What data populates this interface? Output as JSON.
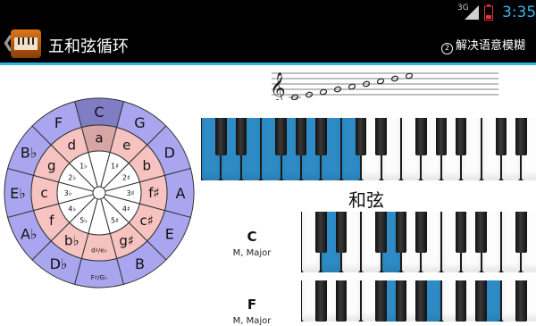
{
  "status_bar": {
    "network": "3G",
    "time": "3:35"
  },
  "app": {
    "title": "五和弦循环",
    "fuzzy_label": "解决语意模糊",
    "back_icon": "chevron-left-icon",
    "fuzzy_icon": "circle-2-icon"
  },
  "staff": {
    "notes": [
      "C4",
      "D4",
      "E4",
      "F4",
      "G4",
      "A4",
      "B4",
      "C5",
      "D5"
    ]
  },
  "circle": {
    "outer": [
      "C",
      "G",
      "D",
      "A",
      "E",
      "B",
      "F♯/G♭",
      "D♭",
      "A♭",
      "E♭",
      "B♭",
      "F"
    ],
    "middle": [
      "a",
      "e",
      "b",
      "f♯",
      "c♯",
      "g♯",
      "d♯/e♭",
      "b♭",
      "f",
      "c",
      "g",
      "d"
    ],
    "inner": [
      "",
      "1♯",
      "2♯",
      "3♯",
      "4♯",
      "5♯",
      "",
      "5♭",
      "4♭",
      "3♭",
      "2♭",
      "1♭"
    ],
    "selected_index": 0,
    "colors": {
      "outer": "#a9a6ef",
      "outer_selected": "#7f7dc4",
      "middle": "#f6c3c1",
      "middle_selected": "#d7a5a4",
      "inner": "#ffffff"
    }
  },
  "keyboard": {
    "highlight_color": "#2e8bc6"
  },
  "chords": {
    "title": "和弦",
    "items": [
      {
        "name": "C",
        "sub": "M, Major"
      },
      {
        "name": "F",
        "sub": "M, Major"
      }
    ]
  }
}
